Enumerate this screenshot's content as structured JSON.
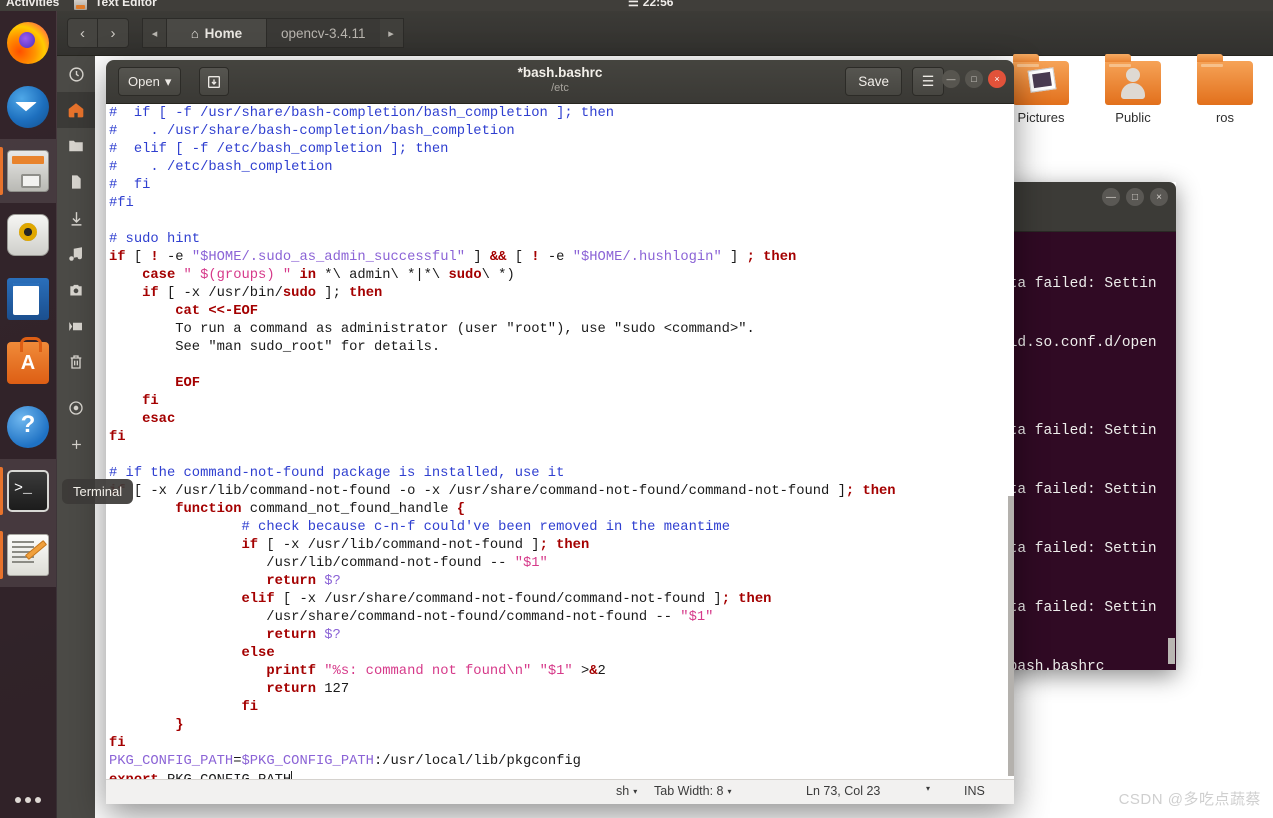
{
  "topbar": {
    "activities": "Activities",
    "app_name": "Text Editor",
    "clock": "22:56",
    "app_icon": "text-editor-icon"
  },
  "dock": {
    "items": [
      {
        "name": "firefox",
        "label": "Firefox",
        "icon": "firefox-icon",
        "active": false
      },
      {
        "name": "thunderbird",
        "label": "Thunderbird Mail",
        "icon": "thunderbird-icon",
        "active": false
      },
      {
        "name": "files",
        "label": "Files",
        "icon": "files-cabinet-icon",
        "active": true
      },
      {
        "name": "rhythmbox",
        "label": "Rhythmbox",
        "icon": "speaker-icon",
        "active": false
      },
      {
        "name": "libreoffice-writer",
        "label": "LibreOffice Writer",
        "icon": "document-icon",
        "active": false
      },
      {
        "name": "software",
        "label": "Ubuntu Software",
        "icon": "shopping-bag-icon",
        "active": false
      },
      {
        "name": "help",
        "label": "Help",
        "icon": "question-mark-icon",
        "active": false
      },
      {
        "name": "terminal",
        "label": "Terminal",
        "icon": "terminal-icon",
        "active": true
      },
      {
        "name": "text-editor",
        "label": "Text Editor",
        "icon": "notepad-pencil-icon",
        "active": true
      }
    ],
    "tooltip": "Terminal",
    "show_apps": "show-applications-icon"
  },
  "files_window": {
    "nav": {
      "back": "‹",
      "forward": "›"
    },
    "tab_prev": "◂",
    "tab_next": "▸",
    "tabs": [
      {
        "label": "Home",
        "icon": "home-icon",
        "active": true
      },
      {
        "label": "opencv-3.4.11",
        "icon": "",
        "active": false
      }
    ],
    "sidebar": [
      {
        "name": "recent",
        "icon": "clock-icon"
      },
      {
        "name": "home",
        "icon": "home-icon",
        "active": true
      },
      {
        "name": "documents",
        "icon": "folder-icon"
      },
      {
        "name": "desktop",
        "icon": "file-icon"
      },
      {
        "name": "downloads",
        "icon": "download-arrow-icon"
      },
      {
        "name": "music",
        "icon": "music-note-icon"
      },
      {
        "name": "pictures",
        "icon": "camera-icon"
      },
      {
        "name": "videos",
        "icon": "video-camera-icon"
      },
      {
        "name": "trash",
        "icon": "trash-icon"
      },
      {
        "name": "other-locations",
        "icon": "disc-icon"
      },
      {
        "name": "add-bookmark",
        "icon": "plus-icon"
      }
    ],
    "files": [
      {
        "label": "Pictures",
        "icon": "folder-pictures-icon"
      },
      {
        "label": "Public",
        "icon": "folder-public-icon"
      },
      {
        "label": "ros",
        "icon": "folder-icon"
      }
    ]
  },
  "terminal_window": {
    "minimize": "—",
    "maximize": "□",
    "close": "×",
    "lines": [
      "",
      "ata failed: Settin",
      "",
      "/ld.so.conf.d/open",
      "",
      "",
      "ata failed: Settin",
      "",
      "ata failed: Settin",
      "",
      "ata failed: Settin",
      "",
      "ata failed: Settin",
      "",
      "/bash.bashrc"
    ]
  },
  "gedit": {
    "open_label": "Open",
    "open_caret": "▾",
    "save_as_icon": "save-as-icon",
    "title": "*bash.bashrc",
    "subtitle": "/etc",
    "save_label": "Save",
    "menu_icon": "hamburger-menu-icon",
    "minimize": "—",
    "maximize": "□",
    "close": "×",
    "status": {
      "language": "sh",
      "tab_width": "Tab Width: 8",
      "position": "Ln 73, Col 23",
      "overwrite_mode": "INS",
      "caret": "▾"
    },
    "code_lines": [
      [
        {
          "t": "#  if [ -f /usr/share/bash-completion/bash_completion ]; then",
          "c": "cmt"
        }
      ],
      [
        {
          "t": "#    . /usr/share/bash-completion/bash_completion",
          "c": "cmt"
        }
      ],
      [
        {
          "t": "#  elif [ -f /etc/bash_completion ]; then",
          "c": "cmt"
        }
      ],
      [
        {
          "t": "#    . /etc/bash_completion",
          "c": "cmt"
        }
      ],
      [
        {
          "t": "#  fi",
          "c": "cmt"
        }
      ],
      [
        {
          "t": "#fi",
          "c": "cmt"
        }
      ],
      [],
      [
        {
          "t": "# sudo hint",
          "c": "cmt"
        }
      ],
      [
        {
          "t": "if",
          "c": "kw"
        },
        {
          "t": " [ ",
          "c": "plain"
        },
        {
          "t": "!",
          "c": "kw"
        },
        {
          "t": " -e ",
          "c": "plain"
        },
        {
          "t": "\"$HOME/.sudo_as_admin_successful\"",
          "c": "var"
        },
        {
          "t": " ] ",
          "c": "plain"
        },
        {
          "t": "&&",
          "c": "kw"
        },
        {
          "t": " [ ",
          "c": "plain"
        },
        {
          "t": "!",
          "c": "kw"
        },
        {
          "t": " -e ",
          "c": "plain"
        },
        {
          "t": "\"$HOME/.hushlogin\"",
          "c": "var"
        },
        {
          "t": " ] ",
          "c": "plain"
        },
        {
          "t": ";",
          "c": "kw"
        },
        {
          "t": " ",
          "c": "plain"
        },
        {
          "t": "then",
          "c": "kw"
        }
      ],
      [
        {
          "t": "    ",
          "c": "plain"
        },
        {
          "t": "case",
          "c": "kw"
        },
        {
          "t": " ",
          "c": "plain"
        },
        {
          "t": "\" ",
          "c": "str"
        },
        {
          "t": "$(groups)",
          "c": "str"
        },
        {
          "t": " \"",
          "c": "str"
        },
        {
          "t": " ",
          "c": "plain"
        },
        {
          "t": "in",
          "c": "kw"
        },
        {
          "t": " *\\ admin\\ *|*\\ ",
          "c": "plain"
        },
        {
          "t": "sudo",
          "c": "kw"
        },
        {
          "t": "\\ *)",
          "c": "plain"
        }
      ],
      [
        {
          "t": "    ",
          "c": "plain"
        },
        {
          "t": "if",
          "c": "kw"
        },
        {
          "t": " [ -x /usr/bin/",
          "c": "plain"
        },
        {
          "t": "sudo",
          "c": "kw"
        },
        {
          "t": " ]; ",
          "c": "plain"
        },
        {
          "t": "then",
          "c": "kw"
        }
      ],
      [
        {
          "t": "        ",
          "c": "plain"
        },
        {
          "t": "cat <<-EOF",
          "c": "kw"
        }
      ],
      [
        {
          "t": "        To run a command as administrator (user \"root\"), use \"sudo <command>\".",
          "c": "plain"
        }
      ],
      [
        {
          "t": "        See \"man sudo_root\" for details.",
          "c": "plain"
        }
      ],
      [],
      [
        {
          "t": "        ",
          "c": "plain"
        },
        {
          "t": "EOF",
          "c": "kw"
        }
      ],
      [
        {
          "t": "    ",
          "c": "plain"
        },
        {
          "t": "fi",
          "c": "kw"
        }
      ],
      [
        {
          "t": "    ",
          "c": "plain"
        },
        {
          "t": "esac",
          "c": "kw"
        }
      ],
      [
        {
          "t": "fi",
          "c": "kw"
        }
      ],
      [],
      [
        {
          "t": "# if the command-not-found package is installed, use it",
          "c": "cmt"
        }
      ],
      [
        {
          "t": "if",
          "c": "kw"
        },
        {
          "t": " [ -x /usr/lib/command-not-found -o -x /usr/share/command-not-found/command-not-found ]",
          "c": "plain"
        },
        {
          "t": ";",
          "c": "kw"
        },
        {
          "t": " ",
          "c": "plain"
        },
        {
          "t": "then",
          "c": "kw"
        }
      ],
      [
        {
          "t": "        ",
          "c": "plain"
        },
        {
          "t": "function",
          "c": "kw"
        },
        {
          "t": " command_not_found_handle ",
          "c": "plain"
        },
        {
          "t": "{",
          "c": "kw"
        }
      ],
      [
        {
          "t": "                ",
          "c": "plain"
        },
        {
          "t": "# check because c-n-f could've been removed in the meantime",
          "c": "cmt"
        }
      ],
      [
        {
          "t": "                ",
          "c": "plain"
        },
        {
          "t": "if",
          "c": "kw"
        },
        {
          "t": " [ -x /usr/lib/command-not-found ]",
          "c": "plain"
        },
        {
          "t": ";",
          "c": "kw"
        },
        {
          "t": " ",
          "c": "plain"
        },
        {
          "t": "then",
          "c": "kw"
        }
      ],
      [
        {
          "t": "                   /usr/lib/command-not-found -- ",
          "c": "plain"
        },
        {
          "t": "\"$1\"",
          "c": "str"
        }
      ],
      [
        {
          "t": "                   ",
          "c": "plain"
        },
        {
          "t": "return",
          "c": "kw"
        },
        {
          "t": " ",
          "c": "plain"
        },
        {
          "t": "$?",
          "c": "var"
        }
      ],
      [
        {
          "t": "                ",
          "c": "plain"
        },
        {
          "t": "elif",
          "c": "kw"
        },
        {
          "t": " [ -x /usr/share/command-not-found/command-not-found ]",
          "c": "plain"
        },
        {
          "t": ";",
          "c": "kw"
        },
        {
          "t": " ",
          "c": "plain"
        },
        {
          "t": "then",
          "c": "kw"
        }
      ],
      [
        {
          "t": "                   /usr/share/command-not-found/command-not-found -- ",
          "c": "plain"
        },
        {
          "t": "\"$1\"",
          "c": "str"
        }
      ],
      [
        {
          "t": "                   ",
          "c": "plain"
        },
        {
          "t": "return",
          "c": "kw"
        },
        {
          "t": " ",
          "c": "plain"
        },
        {
          "t": "$?",
          "c": "var"
        }
      ],
      [
        {
          "t": "                ",
          "c": "plain"
        },
        {
          "t": "else",
          "c": "kw"
        }
      ],
      [
        {
          "t": "                   ",
          "c": "plain"
        },
        {
          "t": "printf",
          "c": "kw"
        },
        {
          "t": " ",
          "c": "plain"
        },
        {
          "t": "\"%s: command not found\\n\"",
          "c": "str"
        },
        {
          "t": " ",
          "c": "plain"
        },
        {
          "t": "\"$1\"",
          "c": "str"
        },
        {
          "t": " >",
          "c": "plain"
        },
        {
          "t": "&",
          "c": "kw"
        },
        {
          "t": "2",
          "c": "plain"
        }
      ],
      [
        {
          "t": "                   ",
          "c": "plain"
        },
        {
          "t": "return",
          "c": "kw"
        },
        {
          "t": " 127",
          "c": "plain"
        }
      ],
      [
        {
          "t": "                ",
          "c": "plain"
        },
        {
          "t": "fi",
          "c": "kw"
        }
      ],
      [
        {
          "t": "        ",
          "c": "plain"
        },
        {
          "t": "}",
          "c": "kw"
        }
      ],
      [
        {
          "t": "fi",
          "c": "kw"
        }
      ],
      [
        {
          "t": "PKG_CONFIG_PATH",
          "c": "var"
        },
        {
          "t": "=",
          "c": "plain"
        },
        {
          "t": "$PKG_CONFIG_PATH",
          "c": "var"
        },
        {
          "t": ":/usr/local/lib/pkgconfig",
          "c": "plain"
        }
      ],
      [
        {
          "t": "export",
          "c": "kw"
        },
        {
          "t": " PKG_CONFIG_PATH",
          "c": "plain"
        },
        {
          "t": "|CARET|",
          "c": "caret"
        }
      ]
    ]
  },
  "watermark": "CSDN @多吃点蔬蔡"
}
